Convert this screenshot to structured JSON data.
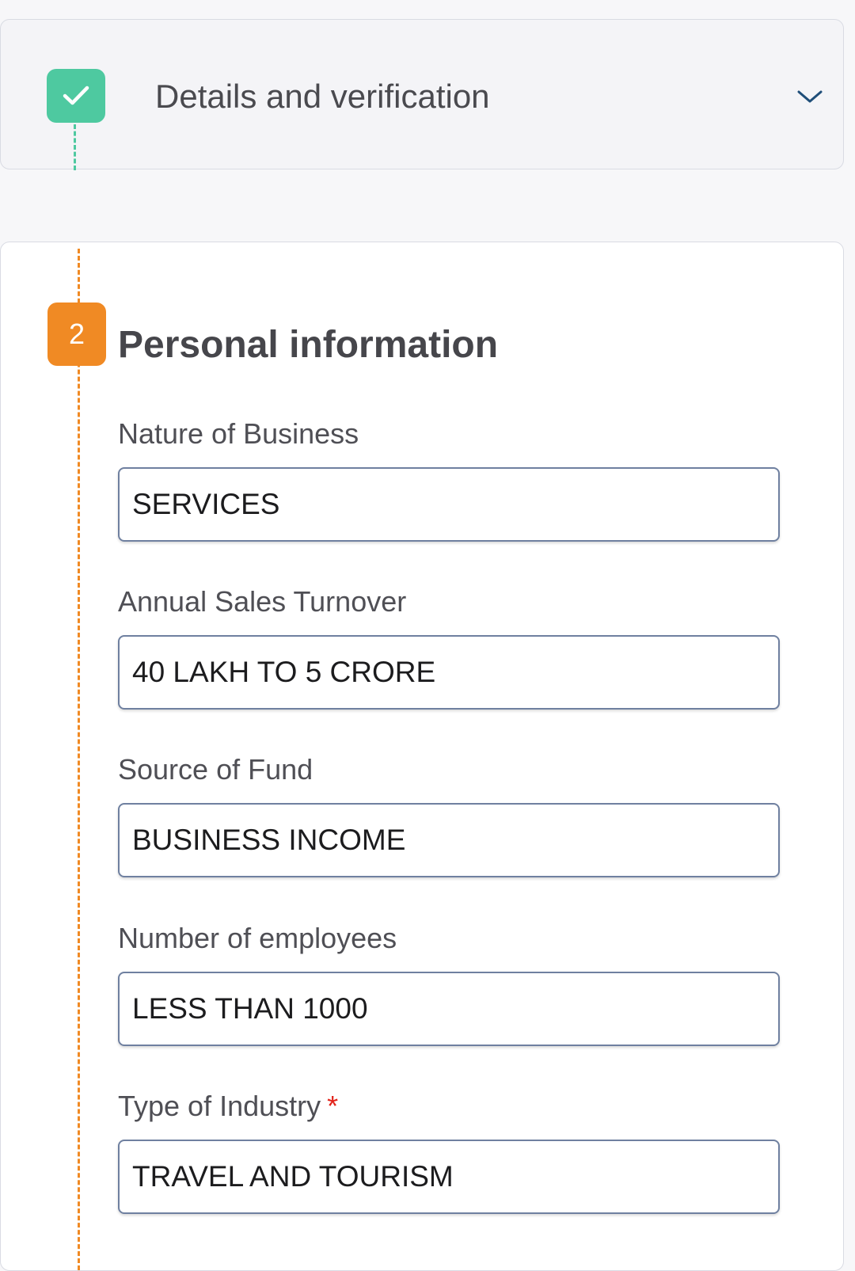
{
  "step1": {
    "title": "Details and verification",
    "status": "completed",
    "accent_color": "#4ec9a0",
    "icon": "checkmark-icon",
    "toggle_icon": "chevron-down-icon"
  },
  "step2": {
    "number": "2",
    "title": "Personal information",
    "accent_color": "#f08a24",
    "fields": [
      {
        "label": "Nature of Business",
        "value": "SERVICES",
        "required": false
      },
      {
        "label": "Annual Sales Turnover",
        "value": "40 LAKH TO 5 CRORE",
        "required": false
      },
      {
        "label": "Source of Fund",
        "value": "BUSINESS INCOME",
        "required": false
      },
      {
        "label": "Number of employees",
        "value": "LESS THAN 1000",
        "required": false
      },
      {
        "label": "Type of Industry",
        "value": "TRAVEL AND TOURISM",
        "required": true,
        "required_mark": "*"
      }
    ]
  }
}
